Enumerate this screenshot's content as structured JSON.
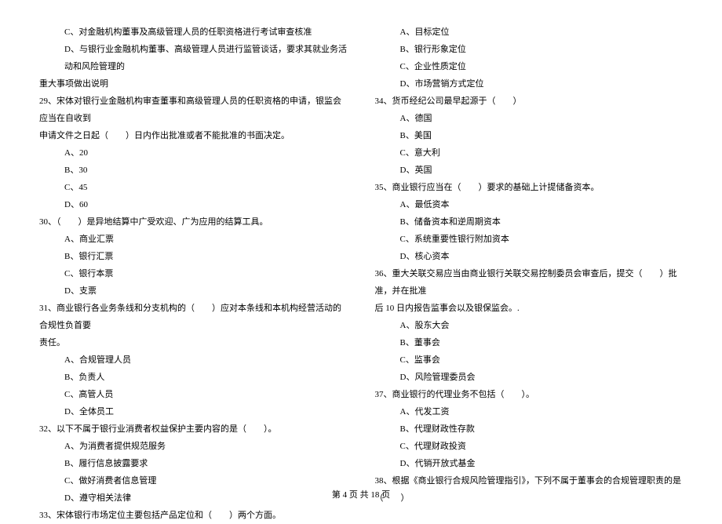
{
  "left": {
    "q28c": "C、对金融机构董事及高级管理人员的任职资格进行考试审查核准",
    "q28d": "D、与银行业金融机构董事、高级管理人员进行监管谈话，要求其就业务活动和风险管理的",
    "q28d2": "重大事项做出说明",
    "q29": "29、宋体对银行业金融机构审查董事和高级管理人员的任职资格的申请，银监会应当在自收到",
    "q29_2": "申请文件之日起（　　）日内作出批准或者不能批准的书面决定。",
    "q29a": "A、20",
    "q29b": "B、30",
    "q29c": "C、45",
    "q29d": "D、60",
    "q30": "30、（　　）是异地结算中广受欢迎、广为应用的结算工具。",
    "q30a": "A、商业汇票",
    "q30b": "B、银行汇票",
    "q30c": "C、银行本票",
    "q30d": "D、支票",
    "q31": "31、商业银行各业务条线和分支机构的（　　）应对本条线和本机构经营活动的合规性负首要",
    "q31_2": "责任。",
    "q31a": "A、合规管理人员",
    "q31b": "B、负责人",
    "q31c": "C、高管人员",
    "q31d": "D、全体员工",
    "q32": "32、以下不属于银行业消费者权益保护主要内容的是（　　）。",
    "q32a": "A、为消费者提供规范服务",
    "q32b": "B、履行信息披露要求",
    "q32c": "C、做好消费者信息管理",
    "q32d": "D、遵守相关法律",
    "q33": "33、宋体银行市场定位主要包括产品定位和（　　）两个方面。"
  },
  "right": {
    "q33a": "A、目标定位",
    "q33b": "B、银行形象定位",
    "q33c": "C、企业性质定位",
    "q33d": "D、市场营销方式定位",
    "q34": "34、货币经纪公司最早起源于（　　）",
    "q34a": "A、德国",
    "q34b": "B、美国",
    "q34c": "C、意大利",
    "q34d": "D、英国",
    "q35": "35、商业银行应当在（　　）要求的基础上计提储备资本。",
    "q35a": "A、最低资本",
    "q35b": "B、储备资本和逆周期资本",
    "q35c": "C、系统重要性银行附加资本",
    "q35d": "D、核心资本",
    "q36": "36、重大关联交易应当由商业银行关联交易控制委员会审查后，提交（　　）批准，并在批准",
    "q36_2": "后 10 日内报告监事会以及银保监会。.",
    "q36a": "A、股东大会",
    "q36b": "B、董事会",
    "q36c": "C、监事会",
    "q36d": "D、风险管理委员会",
    "q37": "37、商业银行的代理业务不包括（　　）。",
    "q37a": "A、代发工资",
    "q37b": "B、代理财政性存款",
    "q37c": "C、代理财政投资",
    "q37d": "D、代销开放式基金",
    "q38": "38、根据《商业银行合规风险管理指引》，下列不属于董事会的合规管理职责的是（　　）"
  },
  "footer": "第 4 页 共 18 页"
}
